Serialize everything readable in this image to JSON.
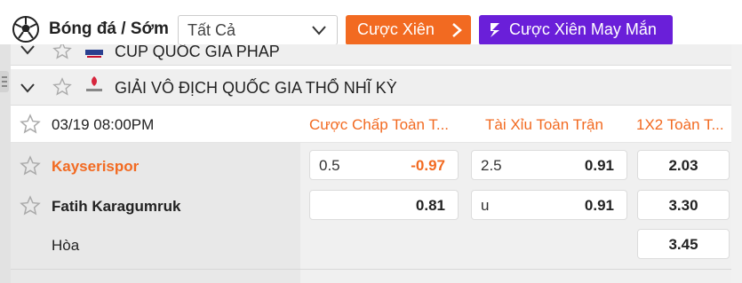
{
  "header": {
    "title": "Bóng đá / Sớm",
    "filter_value": "Tất Cả",
    "parlay_button": "Cược Xiên",
    "lucky_parlay_button": "Cược Xiên May Mắn",
    "colors": {
      "orange": "#f26a21",
      "purple": "#6a1fd9"
    }
  },
  "leagues": [
    {
      "name": "CÚP QUỐC GIA PHÁP",
      "logo_icon": "coupe-de-france-logo"
    },
    {
      "name": "GIẢI VÔ ĐỊCH QUỐC GIA THỔ NHĨ KỲ",
      "logo_icon": "super-lig-logo"
    }
  ],
  "match": {
    "time": "03/19 08:00PM",
    "columns": [
      "Cược Chấp Toàn T...",
      "Tài Xỉu Toàn Trận",
      "1X2 Toàn T..."
    ],
    "home_team": "Kayserispor",
    "away_team": "Fatih Karagumruk",
    "draw_label": "Hòa",
    "handicap": {
      "home_line": "0.5",
      "home_odds": "-0.97",
      "away_line": "",
      "away_odds": "0.81"
    },
    "over_under": {
      "over_line": "2.5",
      "over_odds": "0.91",
      "under_line": "u",
      "under_odds": "0.91"
    },
    "x12": {
      "home": "2.03",
      "away": "3.30",
      "draw": "3.45"
    }
  }
}
